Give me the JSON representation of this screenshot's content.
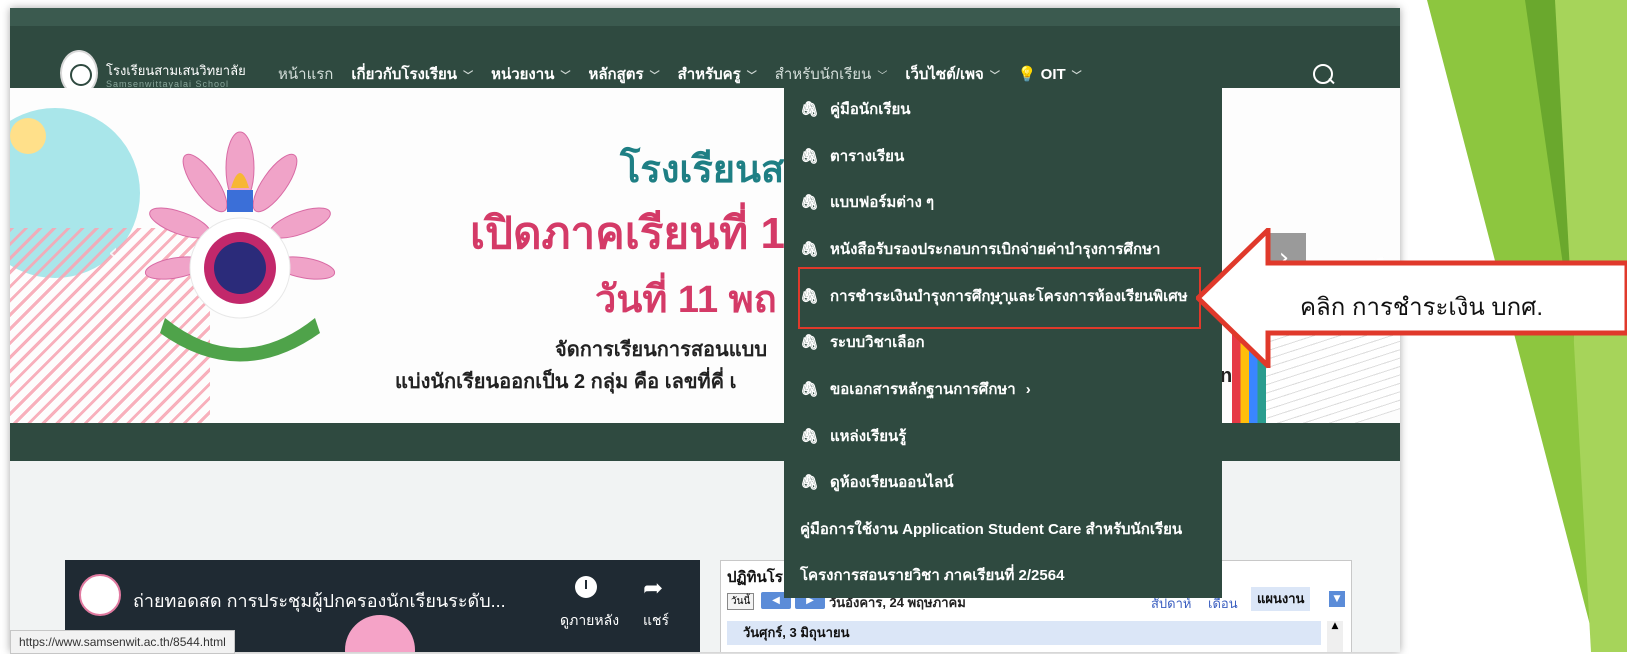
{
  "header": {
    "site_name": "โรงเรียนสามเสนวิทยาลัย",
    "site_sub": "Samsenwittayalai School",
    "menu": [
      "หน้าแรก",
      "เกี่ยวกับโรงเรียน",
      "หน่วยงาน",
      "หลักสูตร",
      "สำหรับครู",
      "สำหรับนักเรียน",
      "เว็บไซต์/เพจ",
      "💡 OIT"
    ]
  },
  "banner": {
    "line1": "โรงเรียนส",
    "line2": "เปิดภาคเรียนที่ 1",
    "line3": "วันที่ 11 พถ",
    "line4": "จัดการเรียนการสอนแบบ",
    "line5": "แบ่งนักเรียนออกเป็น 2 กลุ่ม คือ เลขที่คี่ เ",
    "line5_tail": "ne"
  },
  "dropdown": {
    "items": [
      "คู่มือนักเรียน",
      "ตารางเรียน",
      "แบบฟอร์มต่าง ๆ",
      "หนังสือรับรองประกอบการเบิกจ่ายค่าบำรุงการศึกษา",
      "การชำระเงินบำรุงการศึกษาและโครงการห้องเรียนพิเศษ",
      "ระบบวิชาเลือก",
      "ขอเอกสารหลักฐานการศึกษา",
      "แหล่งเรียนรู้",
      "ดูห้องเรียนออนไลน์",
      "คู่มือการใช้งาน Application Student Care สำหรับนักเรียน",
      "โครงการสอนรายวิชา ภาคเรียนที่ 2/2564"
    ],
    "submenu_arrow": "›"
  },
  "callout": {
    "text": "คลิก การชำระเงิน บกศ."
  },
  "video": {
    "title": "ถ่ายทอดสด การประชุมผู้ปกครองนักเรียนระดับ...",
    "watch_later": "ดูภายหลัง",
    "share": "แชร์"
  },
  "calendar": {
    "title": "ปฏิทินโร",
    "today": "วันนี้",
    "date": "วันอังคาร, 24 พฤษภาคม",
    "week": "สัปดาห์",
    "month": "เดือน",
    "agenda": "แผนงาน",
    "day_row": "วันศุกร์, 3 มิถุนายน"
  },
  "status_url": "https://www.samsenwit.ac.th/8544.html",
  "colors": {
    "nav": "#2f4a40",
    "highlight": "#e0392b",
    "accent_pink": "#d43a67",
    "teal": "#1e7f84"
  }
}
